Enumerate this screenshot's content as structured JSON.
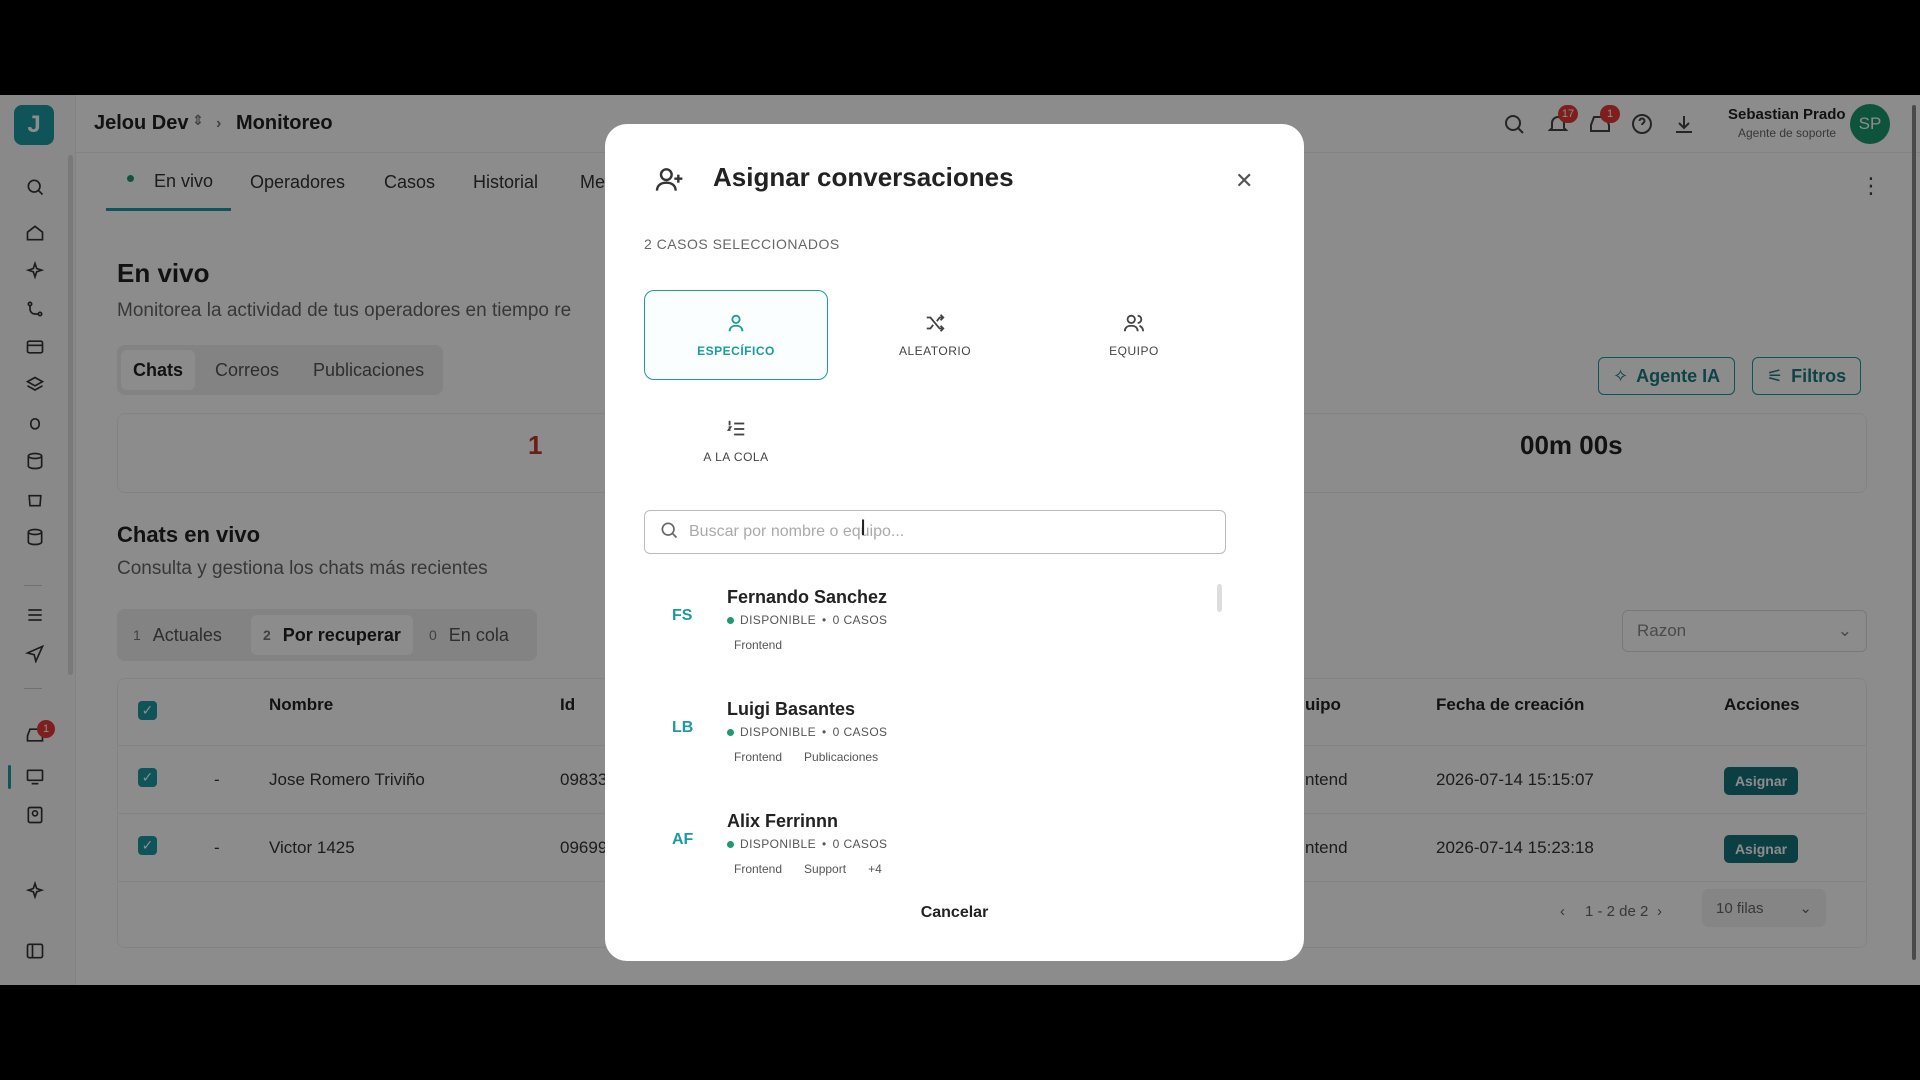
{
  "breadcrumb": {
    "workspace": "Jelou Dev",
    "section": "Monitoreo"
  },
  "user": {
    "name": "Sebastian Prado",
    "role": "Agente de soporte",
    "initials": "SP"
  },
  "notifications": {
    "bell_count": "17",
    "inbox_count": "1"
  },
  "sidebar": {
    "logo": "J",
    "inbox_badge": "1"
  },
  "tabs": [
    "En vivo",
    "Operadores",
    "Casos",
    "Historial",
    "Me"
  ],
  "page": {
    "title": "En vivo",
    "subtitle": "Monitorea la actividad de tus operadores en tiempo re",
    "channels": [
      "Chats",
      "Correos",
      "Publicaciones"
    ],
    "agent_ai_label": "Agente IA",
    "filters_label": "Filtros",
    "stat_left": "1",
    "stat_right": "00m 00s"
  },
  "live_chats": {
    "title": "Chats en vivo",
    "subtitle": "Consulta y gestiona los chats más recientes",
    "segments": [
      {
        "count": "1",
        "label": "Actuales"
      },
      {
        "count": "2",
        "label": "Por recuperar"
      },
      {
        "count": "0",
        "label": "En cola"
      }
    ],
    "reason_placeholder": "Razon",
    "columns": [
      "Nombre",
      "Id",
      "uipo",
      "Fecha de creación",
      "Acciones"
    ],
    "rows": [
      {
        "dash": "-",
        "name": "Jose Romero Triviño",
        "id": "09833",
        "team": "ntend",
        "date": "2026-07-14 15:15:07",
        "action": "Asignar"
      },
      {
        "dash": "-",
        "name": "Victor 1425",
        "id": "09699",
        "team": "ntend",
        "date": "2026-07-14 15:23:18",
        "action": "Asignar"
      }
    ],
    "pagination": "1 - 2 de 2",
    "rows_per_page": "10 filas"
  },
  "modal": {
    "title": "Asignar conversaciones",
    "selected_count": "2 CASOS SELECCIONADOS",
    "options": [
      "ESPECÍFICO",
      "ALEATORIO",
      "EQUIPO",
      "A LA COLA"
    ],
    "search_placeholder": "Buscar por nombre o equipo...",
    "operators": [
      {
        "initials": "FS",
        "name": "Fernando Sanchez",
        "status": "DISPONIBLE",
        "cases": "0 CASOS",
        "tags": [
          "Frontend"
        ]
      },
      {
        "initials": "LB",
        "name": "Luigi Basantes",
        "status": "DISPONIBLE",
        "cases": "0 CASOS",
        "tags": [
          "Frontend",
          "Publicaciones"
        ]
      },
      {
        "initials": "AF",
        "name": "Alix Ferrinnn",
        "status": "DISPONIBLE",
        "cases": "0 CASOS",
        "tags": [
          "Frontend",
          "Support",
          "+4"
        ]
      }
    ],
    "cancel_label": "Cancelar"
  },
  "colors": {
    "accent": "#1b9aa0",
    "available": "#1b9a6e",
    "badge": "#e53935"
  }
}
